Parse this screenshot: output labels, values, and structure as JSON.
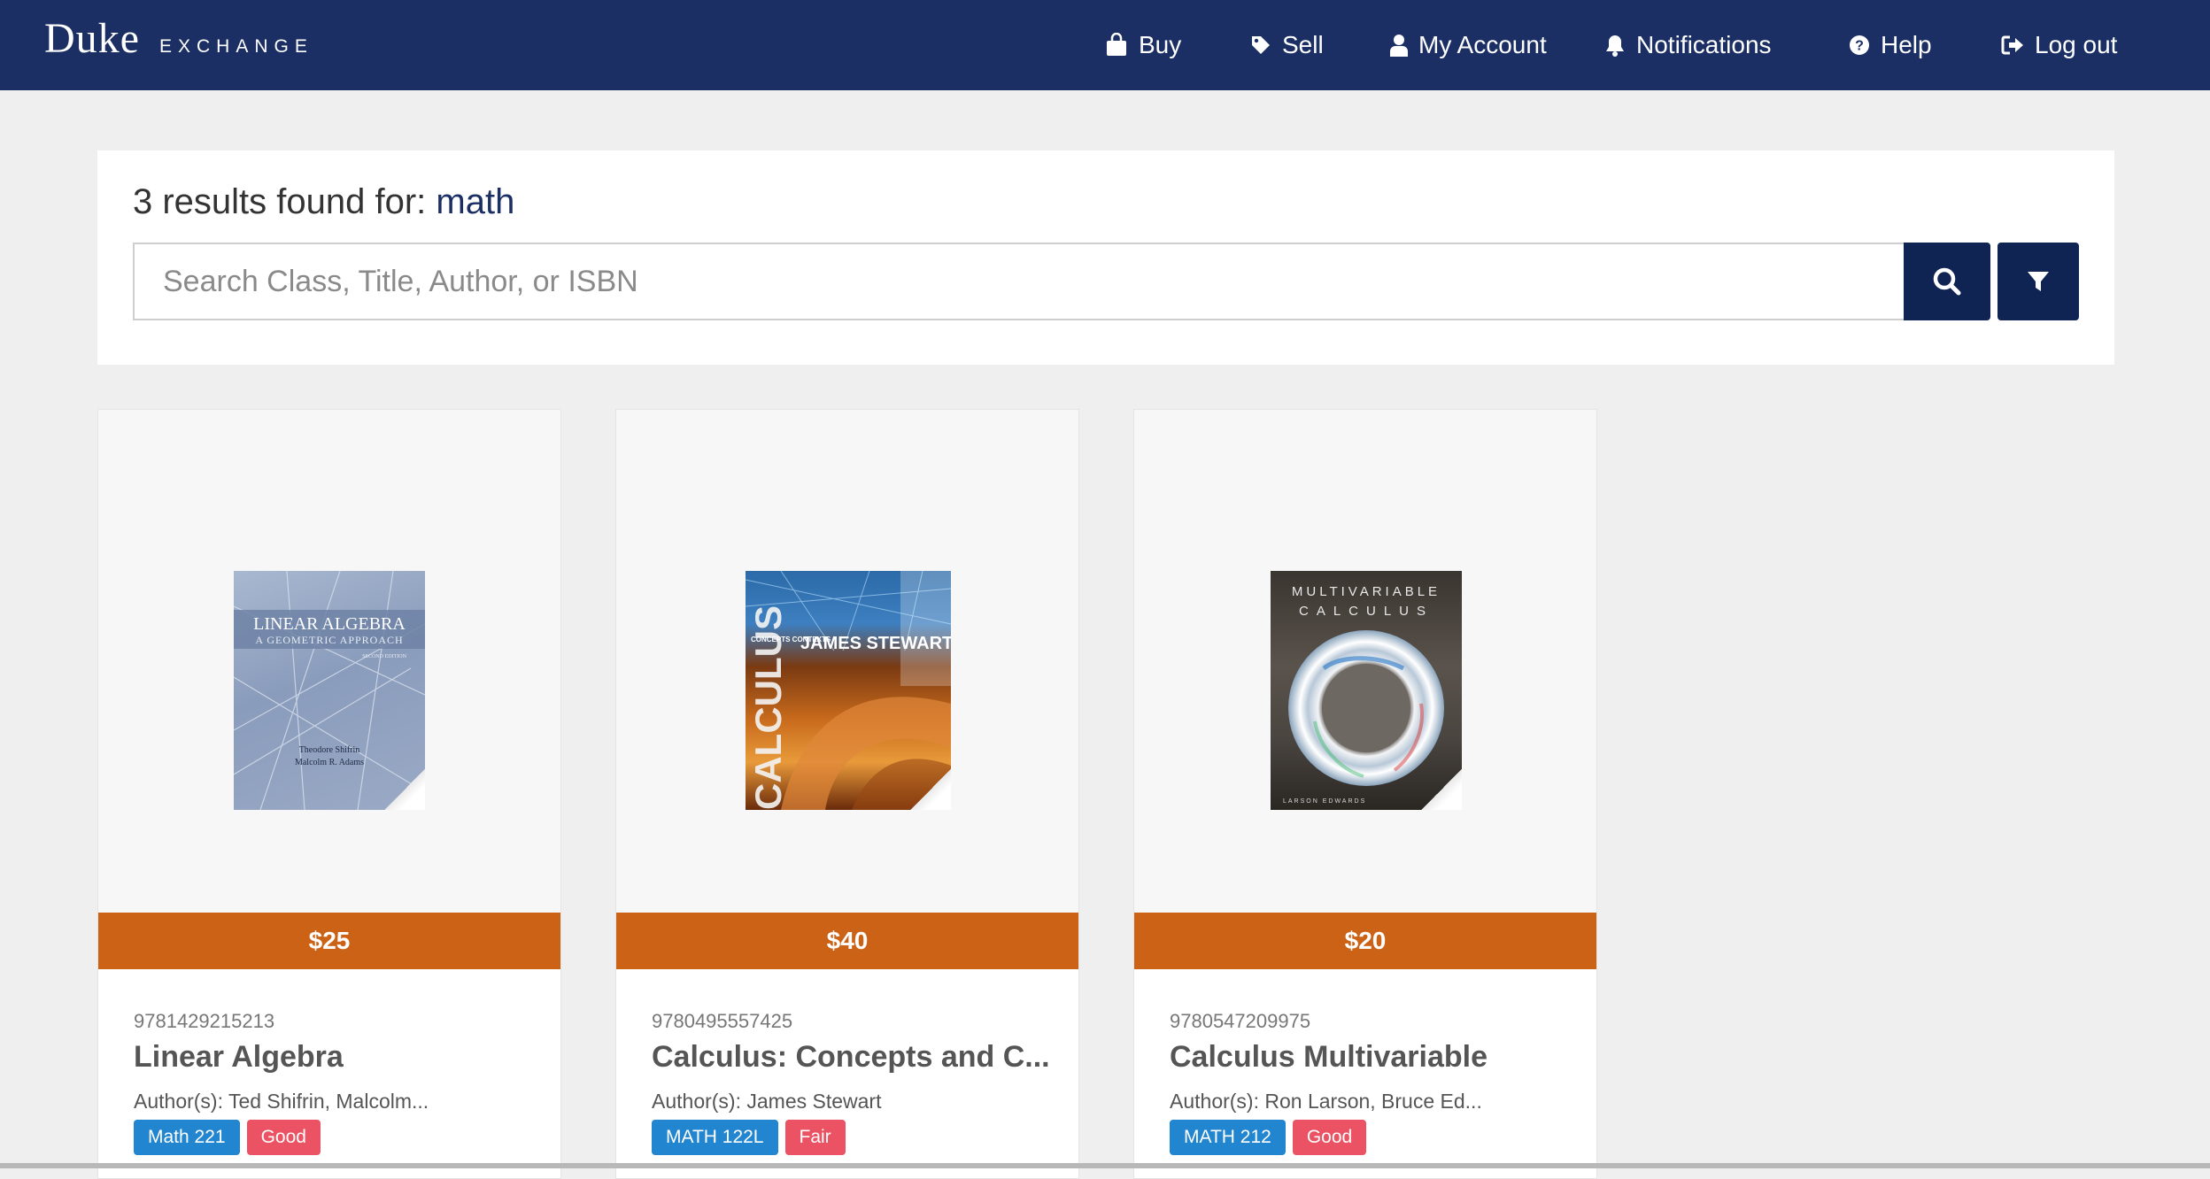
{
  "brand": {
    "main": "Duke",
    "sub": "EXCHANGE"
  },
  "nav": {
    "buy": "Buy",
    "sell": "Sell",
    "account": "My Account",
    "notifications": "Notifications",
    "help": "Help",
    "logout": "Log out"
  },
  "search": {
    "results_prefix": "3 results found for: ",
    "query": "math",
    "placeholder": "Search Class, Title, Author, or ISBN",
    "value": ""
  },
  "books": [
    {
      "price": "$25",
      "isbn": "9781429215213",
      "title": "Linear Algebra",
      "authors": "Author(s): Ted Shifrin, Malcolm...",
      "class": "Math 221",
      "condition": "Good",
      "cover": {
        "line1": "LINEAR ALGEBRA",
        "line2": "A GEOMETRIC APPROACH",
        "line3": "SECOND EDITION",
        "author1": "Theodore Shifrin",
        "author2": "Malcolm R. Adams"
      }
    },
    {
      "price": "$40",
      "isbn": "9780495557425",
      "title": "Calculus: Concepts and C...",
      "authors": "Author(s): James Stewart",
      "class": "MATH 122L",
      "condition": "Fair",
      "cover": {
        "line1": "CALCULUS",
        "line2": "CONCEPTS CONTEXTS",
        "author1": "JAMES STEWART"
      }
    },
    {
      "price": "$20",
      "isbn": "9780547209975",
      "title": "Calculus Multivariable",
      "authors": "Author(s): Ron Larson, Bruce Ed...",
      "class": "MATH 212",
      "condition": "Good",
      "cover": {
        "line1": "MULTIVARIABLE",
        "line2": "CALCULUS",
        "author1": "LARSON  EDWARDS"
      }
    }
  ],
  "colors": {
    "navbar": "#1b2f64",
    "button": "#0f2453",
    "price": "#cc6215",
    "class_tag": "#2185d0",
    "condition_tag": "#eb5263"
  }
}
